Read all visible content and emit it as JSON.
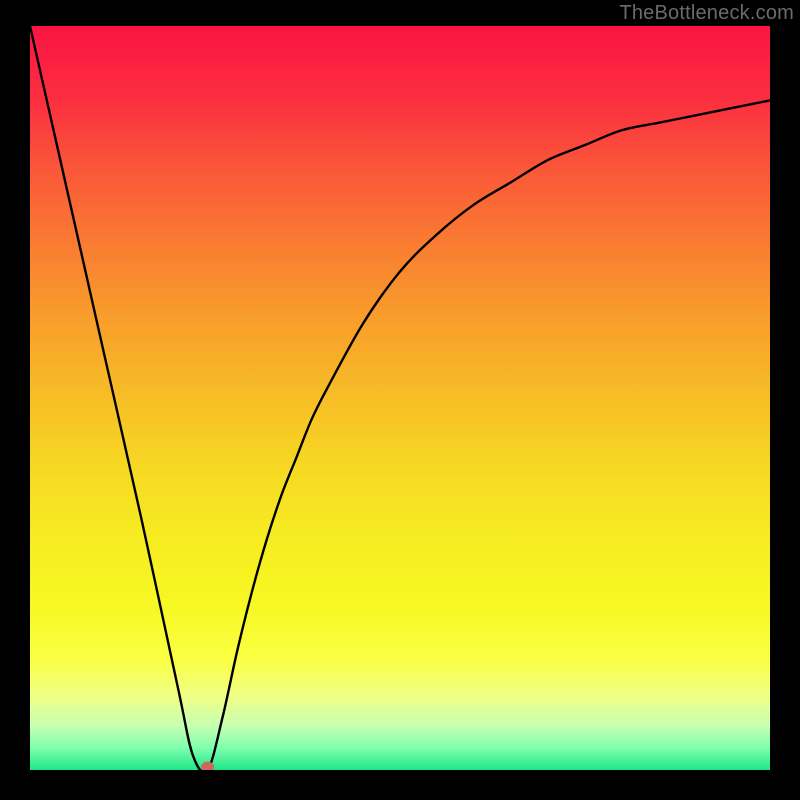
{
  "watermark": "TheBottleneck.com",
  "chart_data": {
    "type": "line",
    "title": "",
    "xlabel": "",
    "ylabel": "",
    "xlim": [
      0,
      100
    ],
    "ylim": [
      0,
      100
    ],
    "background": "rainbow-gradient-red-top-green-bottom",
    "series": [
      {
        "name": "bottleneck-curve",
        "x": [
          0,
          5,
          10,
          15,
          20,
          22,
          24,
          26,
          28,
          30,
          32,
          34,
          36,
          38,
          40,
          45,
          50,
          55,
          60,
          65,
          70,
          75,
          80,
          85,
          90,
          95,
          100
        ],
        "y": [
          100,
          78,
          56,
          34,
          11,
          2,
          0,
          7,
          16,
          24,
          31,
          37,
          42,
          47,
          51,
          60,
          67,
          72,
          76,
          79,
          82,
          84,
          86,
          87,
          88,
          89,
          90
        ]
      }
    ],
    "marker": {
      "x": 24,
      "y": 0,
      "color": "#c96a5c"
    },
    "gradient_stops": [
      {
        "offset": 0.0,
        "color": "#fb1444"
      },
      {
        "offset": 0.1,
        "color": "#fb2f3f"
      },
      {
        "offset": 0.2,
        "color": "#fa5a38"
      },
      {
        "offset": 0.3,
        "color": "#f97f31"
      },
      {
        "offset": 0.4,
        "color": "#f8a02b"
      },
      {
        "offset": 0.5,
        "color": "#f7be26"
      },
      {
        "offset": 0.6,
        "color": "#f6da22"
      },
      {
        "offset": 0.7,
        "color": "#f6ee21"
      },
      {
        "offset": 0.78,
        "color": "#f7f824"
      },
      {
        "offset": 0.85,
        "color": "#faff42"
      },
      {
        "offset": 0.9,
        "color": "#f0ff85"
      },
      {
        "offset": 0.94,
        "color": "#c8ffb0"
      },
      {
        "offset": 0.97,
        "color": "#7fffad"
      },
      {
        "offset": 1.0,
        "color": "#20e688"
      }
    ]
  }
}
